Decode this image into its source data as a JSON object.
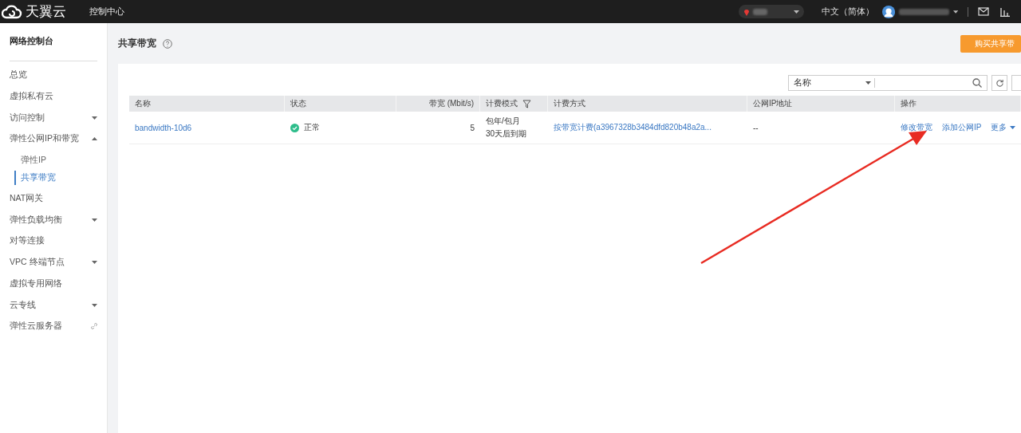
{
  "topbar": {
    "logo": "天翼云",
    "nav": "控制中心",
    "language": "中文（简体）"
  },
  "sidebar": {
    "title": "网络控制台",
    "items": [
      {
        "label": "总览",
        "kind": "plain"
      },
      {
        "label": "虚拟私有云",
        "kind": "plain"
      },
      {
        "label": "访问控制",
        "kind": "group",
        "expanded": false
      },
      {
        "label": "弹性公网IP和带宽",
        "kind": "group",
        "expanded": true,
        "children": [
          {
            "label": "弹性IP",
            "selected": false
          },
          {
            "label": "共享带宽",
            "selected": true
          }
        ]
      },
      {
        "label": "NAT网关",
        "kind": "plain"
      },
      {
        "label": "弹性负载均衡",
        "kind": "group",
        "expanded": false
      },
      {
        "label": "对等连接",
        "kind": "plain"
      },
      {
        "label": "VPC 终端节点",
        "kind": "group",
        "expanded": false
      },
      {
        "label": "虚拟专用网络",
        "kind": "plain"
      },
      {
        "label": "云专线",
        "kind": "group",
        "expanded": false
      },
      {
        "label": "弹性云服务器",
        "kind": "external"
      }
    ]
  },
  "page": {
    "title": "共享带宽",
    "buy_button": "购买共享带"
  },
  "search": {
    "filter": "名称"
  },
  "table": {
    "columns": [
      {
        "label": "名称",
        "filter": false
      },
      {
        "label": "状态",
        "filter": false
      },
      {
        "label": "带宽 (Mbit/s)",
        "filter": false
      },
      {
        "label": "计费模式",
        "filter": true
      },
      {
        "label": "计费方式",
        "filter": false
      },
      {
        "label": "公网IP地址",
        "filter": false
      },
      {
        "label": "操作",
        "filter": false
      }
    ],
    "rows": [
      {
        "name": "bandwidth-10d6",
        "status": "正常",
        "bandwidth": "5",
        "billing_mode": [
          "包年/包月",
          "30天后到期"
        ],
        "billing_method": "按带宽计费(a3967328b3484dfd820b48a2a...",
        "public_ip": "--",
        "actions": [
          "修改带宽",
          "添加公网IP"
        ],
        "more": "更多"
      }
    ]
  }
}
